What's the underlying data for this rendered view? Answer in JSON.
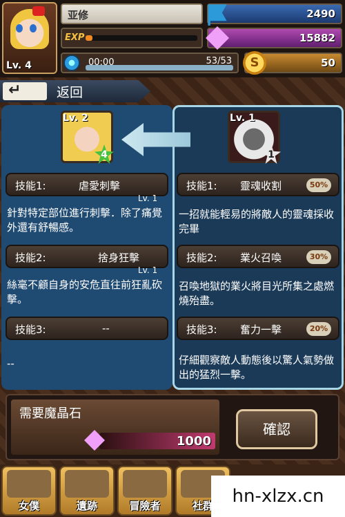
{
  "header": {
    "player_name": "亚修",
    "level_label": "Lv. 4",
    "exp_label": "EXP",
    "exp_progress": 0.06,
    "stamina_timer": "00:00",
    "stamina_count": "53/53",
    "stamina_progress": 1.0,
    "flag_value": "2490",
    "gem_value": "15882",
    "coin_value": "50",
    "coin_symbol": "S"
  },
  "back": {
    "arrow": "↵",
    "label": "返回"
  },
  "left_card": {
    "level": "Lv. 2",
    "star": "4",
    "skills": [
      {
        "label": "技能1:",
        "name": "虐愛刺擊",
        "lv": "Lv. 1",
        "desc": "針對特定部位進行刺擊．除了痛覺外還有舒暢感。"
      },
      {
        "label": "技能2:",
        "name": "捨身狂擊",
        "lv": "Lv. 1",
        "desc": "絲毫不顧自身的安危直往前狂亂砍擊。"
      },
      {
        "label": "技能3:",
        "name": "--",
        "lv": "",
        "desc": "--"
      }
    ]
  },
  "right_card": {
    "level": "Lv. 1",
    "star": "1",
    "skills": [
      {
        "label": "技能1:",
        "name": "靈魂收割",
        "pct": "50%",
        "desc": "一招就能輕易的將敵人的靈魂採收完畢"
      },
      {
        "label": "技能2:",
        "name": "業火召喚",
        "pct": "30%",
        "desc": "召喚地獄的業火將目光所集之處燃燒殆盡。"
      },
      {
        "label": "技能3:",
        "name": "奮力一擊",
        "pct": "20%",
        "desc": "仔細觀察敵人動態後以驚人氣勢做出的猛烈一擊。"
      }
    ]
  },
  "cost": {
    "label": "需要魔晶石",
    "value": "1000",
    "confirm": "確認"
  },
  "nav": [
    {
      "label": "女僕"
    },
    {
      "label": "遺跡"
    },
    {
      "label": "冒險者"
    },
    {
      "label": "社群"
    }
  ],
  "watermark": "hn-xlzx.cn",
  "colors": {
    "gem": "#f0a0f8",
    "accent_panel": "#a8d8e8",
    "exp_fill": "#f08a20"
  },
  "icons": [
    "flag-icon",
    "gem-icon",
    "coin-icon",
    "stamina-icon",
    "back-arrow-icon"
  ]
}
